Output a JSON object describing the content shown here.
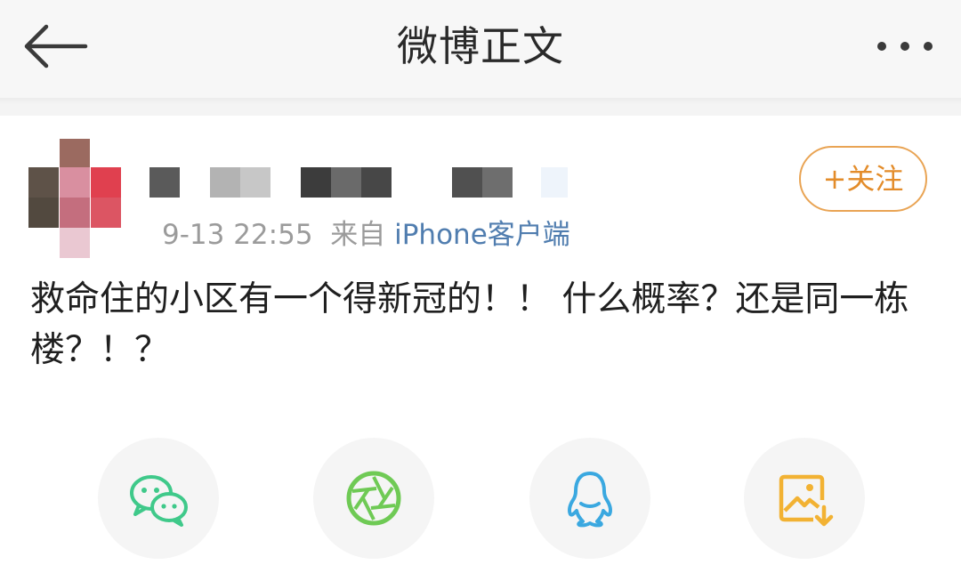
{
  "navbar": {
    "title": "微博正文",
    "back_icon": "arrow-left-icon",
    "more_icon": "more-dots-icon"
  },
  "post": {
    "time": "9-13 22:55",
    "source_prefix": "来自",
    "source": "iPhone客户端",
    "follow_label": "+关注",
    "text": "救命住的小区有一个得新冠的！！ 什么概率？还是同一栋楼？！？"
  },
  "share": {
    "items": [
      {
        "icon": "wechat-icon",
        "color": "#3fc98a"
      },
      {
        "icon": "moments-icon",
        "color": "#6fca55"
      },
      {
        "icon": "qq-icon",
        "color": "#3aa8e0"
      },
      {
        "icon": "save-image-icon",
        "color": "#f2b233"
      }
    ]
  },
  "colors": {
    "accent": "#e38c2a",
    "link": "#507daf",
    "meta": "#9b9b9b"
  }
}
